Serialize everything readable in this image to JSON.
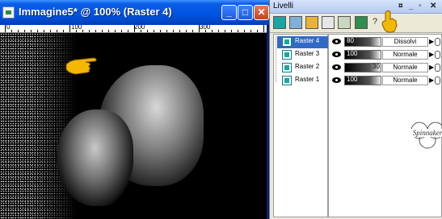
{
  "window": {
    "title": "Immagine5* @ 100% (Raster 4)",
    "ruler_labels": [
      "0",
      "100",
      "200",
      "300"
    ]
  },
  "layers_palette": {
    "title": "Livelli",
    "toolbar_help": "?",
    "layers": [
      {
        "name": "Raster 4",
        "opacity": "80",
        "blend_mode": "Dissolvi",
        "selected": true
      },
      {
        "name": "Raster 3",
        "opacity": "100",
        "blend_mode": "Normale",
        "selected": false
      },
      {
        "name": "Raster 2",
        "opacity": "30",
        "blend_mode": "Normale",
        "selected": false
      },
      {
        "name": "Raster 1",
        "opacity": "100",
        "blend_mode": "Normale",
        "selected": false
      }
    ],
    "watermark_text": "Spinnaker"
  },
  "colors": {
    "titlebar_blue": "#0054e3",
    "selection_blue": "#316ac5",
    "layer_icon_teal": "#19a5a5",
    "pointer_hand_yellow": "#f5b800"
  },
  "icons": [
    "app-icon",
    "minimize-icon",
    "maximize-icon",
    "close-icon",
    "hand-pointer-icon",
    "eye-icon",
    "link-icon",
    "layer-icon"
  ]
}
